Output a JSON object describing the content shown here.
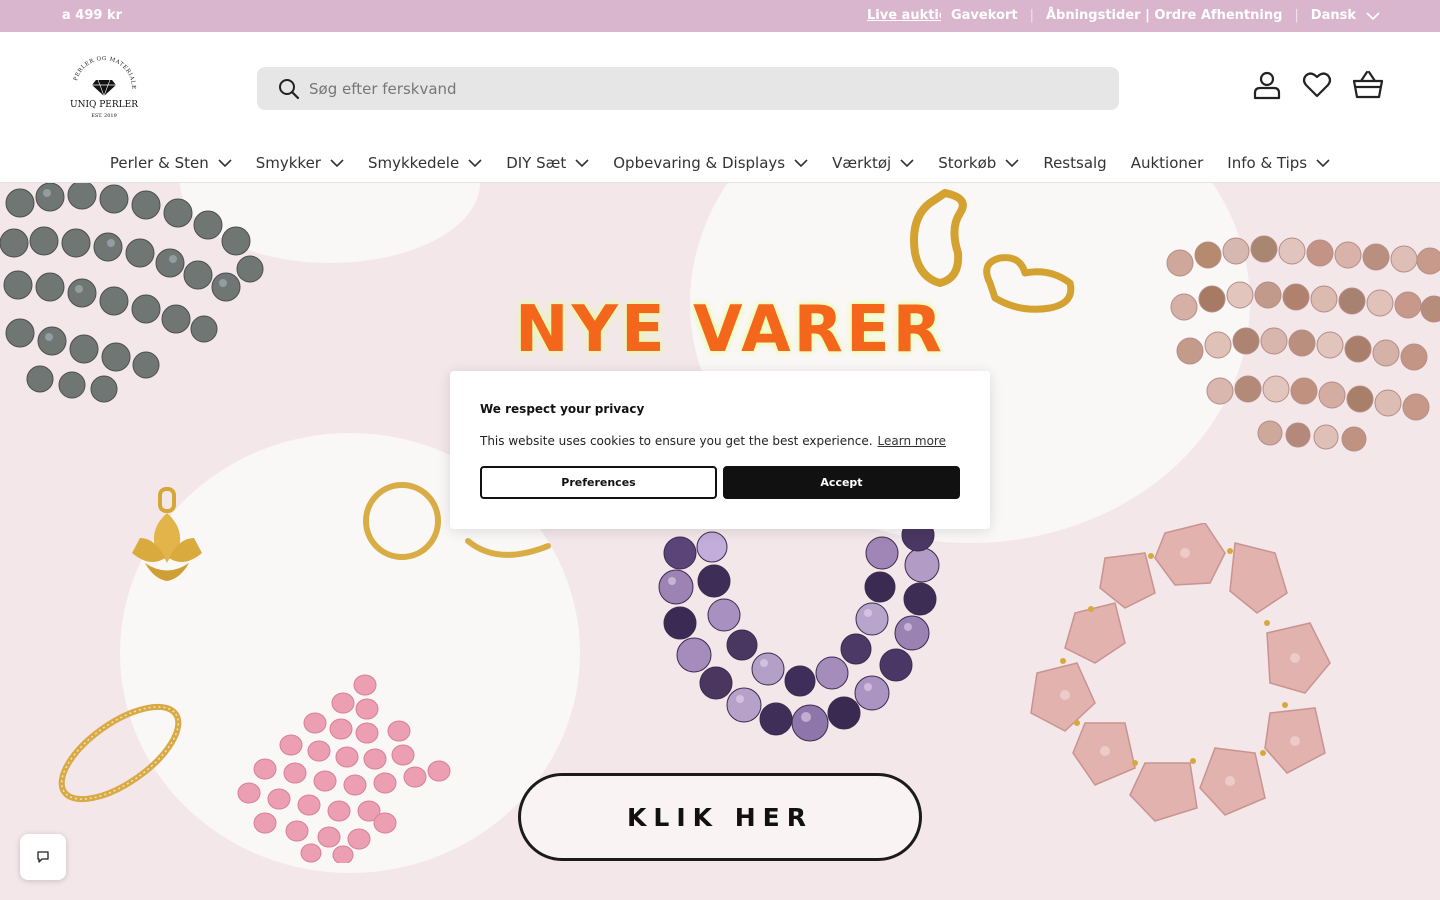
{
  "announcement": {
    "promo": "a 499 kr",
    "live_auction": "Live auktion",
    "gift_card": "Gavekort",
    "separator": "|",
    "hours": "Åbningstider | Ordre Afhentning",
    "language": "Dansk"
  },
  "header": {
    "logo_arc": "PERLER OG MATERIALER",
    "logo_name": "UNIQ PERLER",
    "logo_est": "EST. 2019",
    "search_placeholder": "Søg efter ferskvand"
  },
  "nav": {
    "items": [
      {
        "label": "Perler & Sten",
        "dropdown": true
      },
      {
        "label": "Smykker",
        "dropdown": true
      },
      {
        "label": "Smykkedele",
        "dropdown": true
      },
      {
        "label": "DIY Sæt",
        "dropdown": true
      },
      {
        "label": "Opbevaring & Displays",
        "dropdown": true
      },
      {
        "label": "Værktøj",
        "dropdown": true
      },
      {
        "label": "Storkøb",
        "dropdown": true
      },
      {
        "label": "Restsalg",
        "dropdown": false
      },
      {
        "label": "Auktioner",
        "dropdown": false
      },
      {
        "label": "Info & Tips",
        "dropdown": true
      }
    ]
  },
  "hero": {
    "title": "NYE VARER",
    "cta": "KLIK HER"
  },
  "cookie": {
    "title": "We respect your privacy",
    "message": "This website uses cookies to ensure you get the best experience.",
    "learn_more": "Learn more",
    "preferences": "Preferences",
    "accept": "Accept"
  },
  "colors": {
    "announcement_bg": "#d9b6cd",
    "hero_bg": "#f3e7ea",
    "title_orange": "#f4661b",
    "dark": "#111111"
  },
  "icons": [
    "search-icon",
    "account-icon",
    "wishlist-heart-icon",
    "cart-basket-icon",
    "chevron-down-icon",
    "chat-icon"
  ]
}
